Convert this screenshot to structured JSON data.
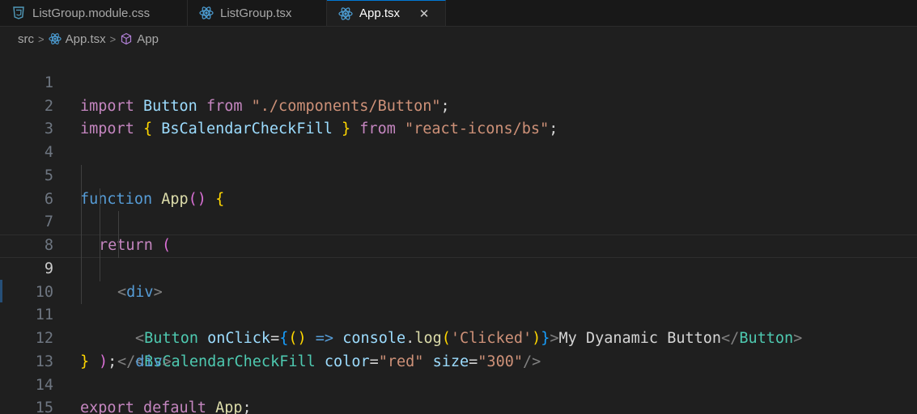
{
  "tabs": [
    {
      "label": "ListGroup.module.css",
      "icon": "css-file-icon"
    },
    {
      "label": "ListGroup.tsx",
      "icon": "react-file-icon"
    },
    {
      "label": "App.tsx",
      "icon": "react-file-icon",
      "active": true
    }
  ],
  "breadcrumb": {
    "folder": "src",
    "file": "App.tsx",
    "symbol": "App"
  },
  "code": {
    "line_numbers": [
      "1",
      "2",
      "3",
      "4",
      "5",
      "6",
      "7",
      "8",
      "9",
      "10",
      "11",
      "12",
      "13",
      "14",
      "15"
    ],
    "current_line": "9",
    "l1": [
      "import",
      " ",
      "Button",
      " ",
      "from",
      " ",
      "\"./components/Button\"",
      ";"
    ],
    "l2": [
      "import",
      " ",
      "{",
      " ",
      "BsCalendarCheckFill",
      " ",
      "}",
      " ",
      "from",
      " ",
      "\"react-icons/bs\"",
      ";"
    ],
    "l5": [
      "function",
      " ",
      "App",
      "()",
      " ",
      "{"
    ],
    "l6": [
      "return",
      " ",
      "("
    ],
    "l7": [
      "<",
      "div",
      ">"
    ],
    "l8": [
      "<",
      "Button",
      " ",
      "onClick",
      "=",
      "{",
      "()",
      " ",
      "=>",
      " ",
      "console",
      ".",
      "log",
      "(",
      "'Clicked'",
      ")",
      "}",
      ">",
      "My Dyanamic Button",
      "</",
      "Button",
      ">"
    ],
    "l9": [
      "<",
      "BsCalendarCheckFill",
      " ",
      "color",
      "=",
      "\"red\"",
      " ",
      "size",
      "=",
      "\"300\"",
      "/>"
    ],
    "l10": [
      "</",
      "div",
      ">"
    ],
    "l11": [
      ")",
      ";"
    ],
    "l12": [
      "}"
    ],
    "l14": [
      "export",
      " ",
      "default",
      " ",
      "App",
      ";"
    ]
  },
  "colors": {
    "background": "#1f1f1f",
    "tab_active_accent": "#0078d4",
    "keyword": "#c586c0",
    "string": "#ce9178",
    "component": "#4ec9b0"
  }
}
